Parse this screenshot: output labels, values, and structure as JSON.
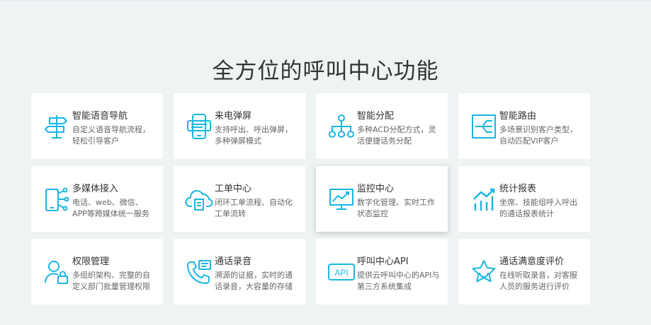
{
  "page": {
    "title": "全方位的呼叫中心功能"
  },
  "colors": {
    "accent": "#19b6e0",
    "text": "#333333",
    "muted": "#666666",
    "background": "#eef3f4"
  },
  "features": [
    {
      "name": "智能语音导航",
      "desc": "自定义语音导航流程，轻松引导客户",
      "icon": "signpost-icon"
    },
    {
      "name": "来电弹屏",
      "desc": "支持呼出、呼出弹屏，多种弹屏模式",
      "icon": "phone-popup-icon"
    },
    {
      "name": "智能分配",
      "desc": "多种ACD分配方式，灵活便捷话务分配",
      "icon": "org-chart-icon"
    },
    {
      "name": "智能路由",
      "desc": "多场景识别客户类型，自动匹配VIP客户",
      "icon": "routing-icon"
    },
    {
      "name": "多媒体接入",
      "desc": "电话、web、微信、APP等跨媒体统一服务",
      "icon": "multimedia-icon"
    },
    {
      "name": "工单中心",
      "desc": "闭环工单流程、自动化工单流转",
      "icon": "cloud-ticket-icon"
    },
    {
      "name": "监控中心",
      "desc": "数字化管理、实时工作状态监控",
      "icon": "monitor-chart-icon"
    },
    {
      "name": "统计报表",
      "desc": "坐席、技能组呼入呼出的通话报表统计",
      "icon": "bar-chart-icon"
    },
    {
      "name": "权限管理",
      "desc": "多组织架构、完整的自定义部门批量管理权限",
      "icon": "user-lock-icon"
    },
    {
      "name": "通话录音",
      "desc": "溯源的证据，实时的通话录音，大容量的存储",
      "icon": "phone-record-icon"
    },
    {
      "name": "呼叫中心API",
      "desc": "提供云呼叫中心的API与第三方系统集成",
      "icon": "api-icon"
    },
    {
      "name": "通话满意度评价",
      "desc": "在线听取录音，对客服人员的服务进行评价",
      "icon": "star-rating-icon"
    }
  ]
}
